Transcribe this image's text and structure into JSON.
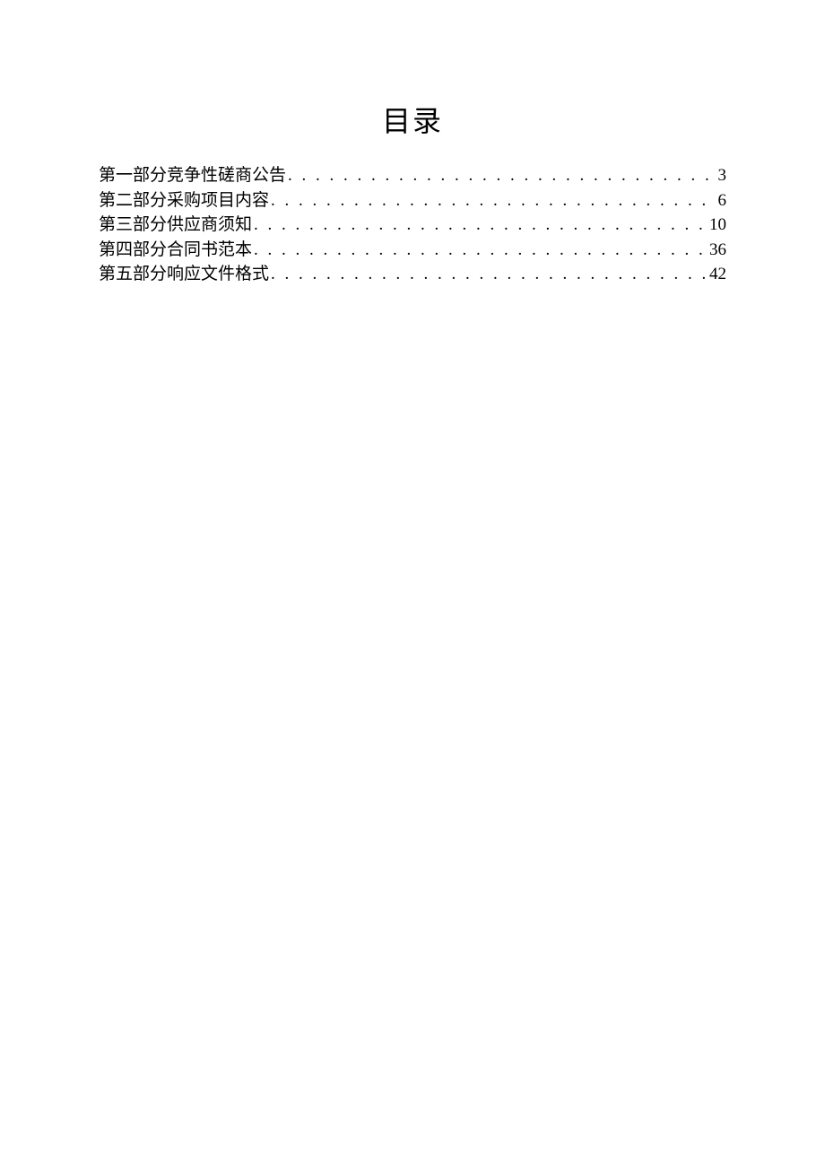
{
  "title": "目录",
  "toc": {
    "entries": [
      {
        "label": "第一部分竞争性磋商公告",
        "page": "3"
      },
      {
        "label": "第二部分采购项目内容",
        "page": "6"
      },
      {
        "label": "第三部分供应商须知",
        "page": "10"
      },
      {
        "label": "第四部分合同书范本",
        "page": "36"
      },
      {
        "label": "第五部分响应文件格式",
        "page": "42"
      }
    ]
  }
}
